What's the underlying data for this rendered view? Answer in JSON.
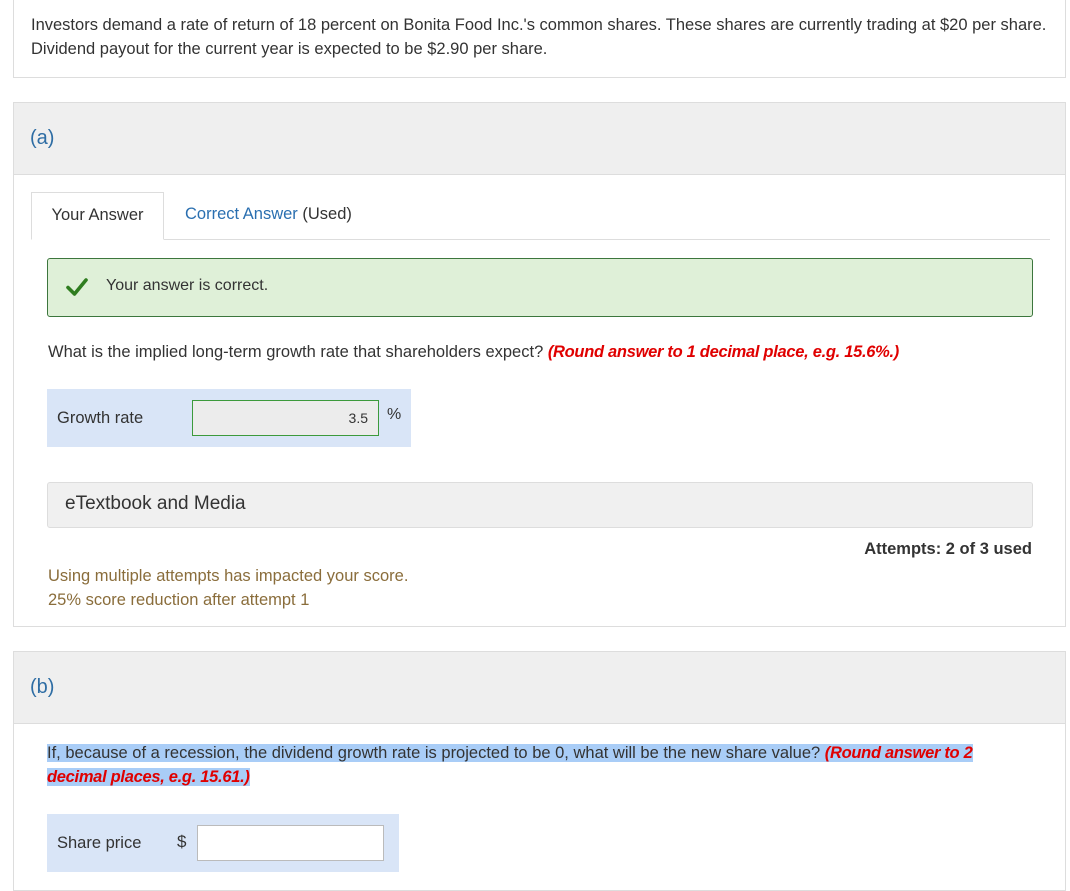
{
  "intro": {
    "text": "Investors demand a rate of return of 18 percent on Bonita Food Inc.'s common shares. These shares are currently trading at $20 per share. Dividend payout for the current year is expected to be $2.90 per share."
  },
  "part_a": {
    "label": "(a)",
    "tabs": {
      "your_answer": "Your Answer",
      "correct_answer_link": "Correct Answer",
      "correct_answer_suffix": " (Used)"
    },
    "feedback": "Your answer is correct.",
    "question": "What is the implied long-term growth rate that shareholders expect? ",
    "rounding_note": "(Round answer to 1 decimal place, e.g. 15.6%.)",
    "answer": {
      "label": "Growth rate",
      "value": "3.5",
      "unit": "%"
    },
    "etextbook": "eTextbook and Media",
    "attempts": "Attempts: 2 of 3 used",
    "penalty_line1": "Using multiple attempts has impacted your score.",
    "penalty_line2": "25% score reduction after attempt 1"
  },
  "part_b": {
    "label": "(b)",
    "question": "If, because of a recession, the dividend growth rate is projected to be 0, what will be the new share value? ",
    "rounding_note": "(Round answer to 2 decimal places, e.g. 15.61.)",
    "answer": {
      "label": "Share price",
      "currency": "$",
      "value": ""
    }
  },
  "colors": {
    "success_bg": "#dff0d8",
    "success_border": "#3c763d",
    "link": "#2a6fb0",
    "warning_text": "#8a6d3b",
    "rounding_red": "#e00000",
    "answer_bg": "#d9e5f7",
    "highlight": "#a9cdf7"
  },
  "icons": {
    "success": "checkmark-icon"
  }
}
